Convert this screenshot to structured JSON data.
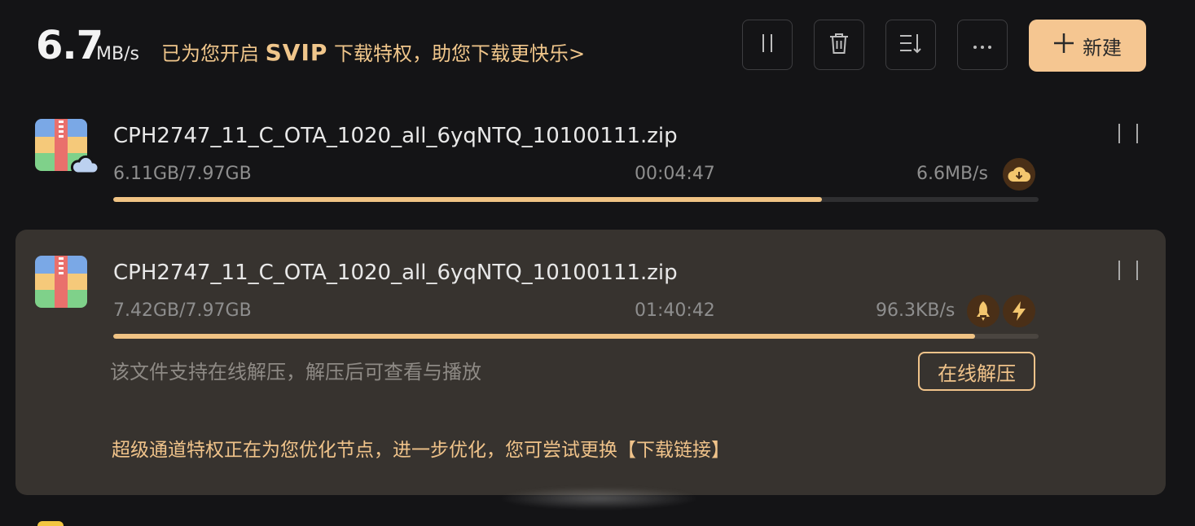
{
  "header": {
    "speed_value": "6.7",
    "speed_unit": "MB/s",
    "promo_prefix": "已为您开启 ",
    "promo_svip": "SVIP",
    "promo_suffix": " 下载特权，助您下载更快乐>",
    "new_label": "新建"
  },
  "toolbar_icons": [
    "pause-all-icon",
    "trash-icon",
    "sort-icon",
    "more-icon",
    "plus-icon"
  ],
  "downloads": [
    {
      "file_name": "CPH2747_11_C_OTA_1020_all_6yqNTQ_10100111.zip",
      "size_progress": "6.11GB/7.97GB",
      "time_left": "00:04:47",
      "speed": "6.6MB/s",
      "progress": 0.766
    },
    {
      "file_name": "CPH2747_11_C_OTA_1020_all_6yqNTQ_10100111.zip",
      "size_progress": "7.42GB/7.97GB",
      "time_left": "01:40:42",
      "speed": "96.3KB/s",
      "progress": 0.931,
      "hint": "该文件支持在线解压，解压后可查看与播放",
      "unzip_label": "在线解压",
      "super_tip": "超级通道特权正在为您优化节点，进一步优化，您可尝试更换【下载链接】"
    }
  ],
  "colors": {
    "accent": "#f0c384",
    "button_bg": "#f5c691",
    "card_bg": "#37332f",
    "page_bg": "#141416"
  }
}
